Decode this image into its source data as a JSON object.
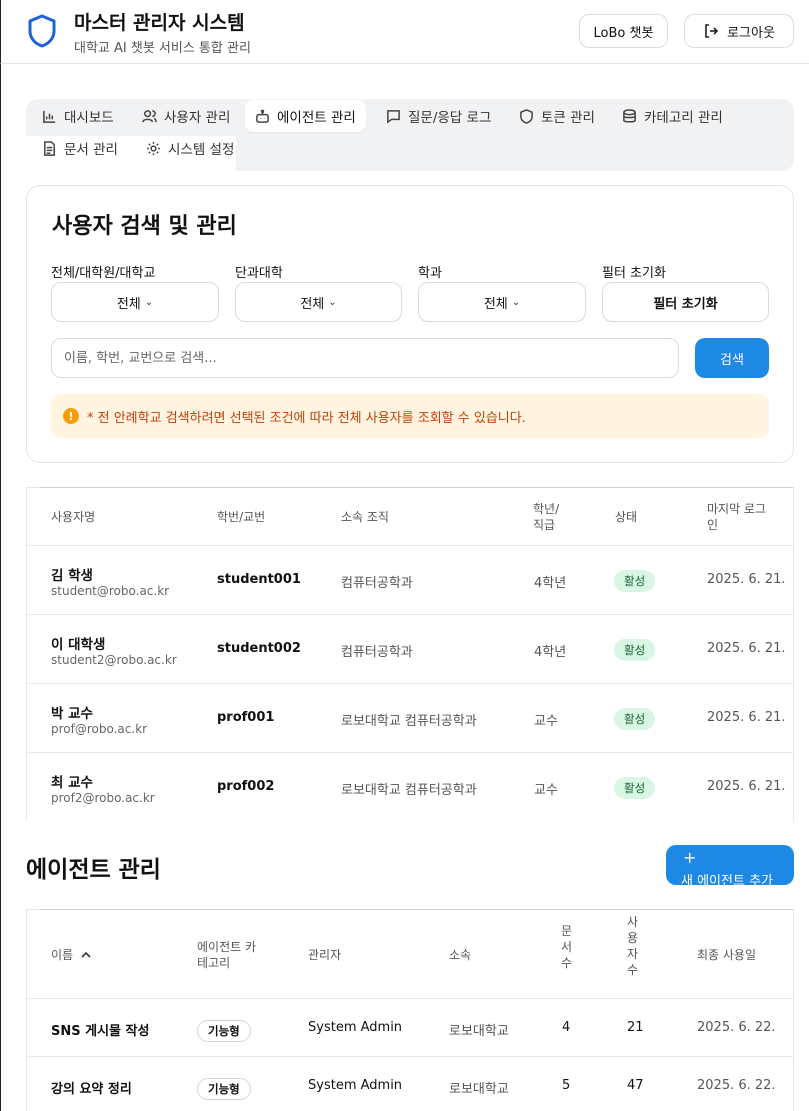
{
  "header": {
    "title": "마스터 관리자 시스템",
    "subtitle": "대학교 AI 챗봇 서비스 통합 관리",
    "chatbot_label": "LoBo 챗봇",
    "logout_label": "로그아웃"
  },
  "tabs": [
    {
      "label": "대시보드",
      "icon": "bar-chart-icon",
      "active": false
    },
    {
      "label": "사용자 관리",
      "icon": "users-icon",
      "active": false
    },
    {
      "label": "에이전트 관리",
      "icon": "bot-icon",
      "active": true
    },
    {
      "label": "질문/응답 로그",
      "icon": "message-icon",
      "active": false
    },
    {
      "label": "토큰 관리",
      "icon": "shield-icon",
      "active": false
    },
    {
      "label": "카테고리 관리",
      "icon": "database-icon",
      "active": false
    },
    {
      "label": "문서 관리",
      "icon": "document-icon",
      "active": false
    },
    {
      "label": "시스템 설정",
      "icon": "gear-icon",
      "active": false
    }
  ],
  "user_search": {
    "title": "사용자 검색 및 관리",
    "filters": [
      {
        "label": "전체/대학원/대학교",
        "value": "전체"
      },
      {
        "label": "단과대학",
        "value": "전체"
      },
      {
        "label": "학과",
        "value": "전체"
      },
      {
        "label": "필터 초기화",
        "value": "필터 초기화"
      }
    ],
    "search_placeholder": "이름, 학번, 교번으로 검색...",
    "search_button": "검색",
    "notice": "* 전 안례학교 검색하려면 선택된 조건에 따라 전체 사용자를 조회할 수 있습니다."
  },
  "users_table": {
    "headers": [
      "사용자명",
      "학번/교번",
      "소속 조직",
      "학년/\n직급",
      "상태",
      "마지막 로그\n인"
    ],
    "rows": [
      {
        "name": "김 학생",
        "email": "student@robo.ac.kr",
        "id": "student001",
        "org": "컴퓨터공학과",
        "grade": "4학년",
        "status": "활성",
        "last_login": "2025. 6. 21."
      },
      {
        "name": "이 대학생",
        "email": "student2@robo.ac.kr",
        "id": "student002",
        "org": "컴퓨터공학과",
        "grade": "4학년",
        "status": "활성",
        "last_login": "2025. 6. 21."
      },
      {
        "name": "박 교수",
        "email": "prof@robo.ac.kr",
        "id": "prof001",
        "org": "로보대학교 컴퓨터공학과",
        "grade": "교수",
        "status": "활성",
        "last_login": "2025. 6. 21."
      },
      {
        "name": "최 교수",
        "email": "prof2@robo.ac.kr",
        "id": "prof002",
        "org": "로보대학교 컴퓨터공학과",
        "grade": "교수",
        "status": "활성",
        "last_login": "2025. 6. 21."
      }
    ]
  },
  "agents": {
    "title": "에이전트 관리",
    "add_button": "새 에이전트 추가",
    "headers": [
      "이름",
      "에이전트 카\n테고리",
      "관리자",
      "소속",
      "문\n서\n수",
      "사\n용\n자\n수",
      "최종 사용일"
    ],
    "rows": [
      {
        "name": "SNS 게시물 작성",
        "category": "기능형",
        "admin": "System Admin",
        "org": "로보대학교",
        "docs": "4",
        "users": "21",
        "last_used": "2025. 6. 22."
      },
      {
        "name": "강의 요약 정리",
        "category": "기능형",
        "admin": "System Admin",
        "org": "로보대학교",
        "docs": "5",
        "users": "47",
        "last_used": "2025. 6. 22."
      }
    ]
  },
  "colors": {
    "primary": "#1e88e5",
    "active_badge_bg": "#d9f5e3",
    "notice_bg": "#fff4e0",
    "notice_text": "#c2410c",
    "logo": "#1e63d6"
  }
}
